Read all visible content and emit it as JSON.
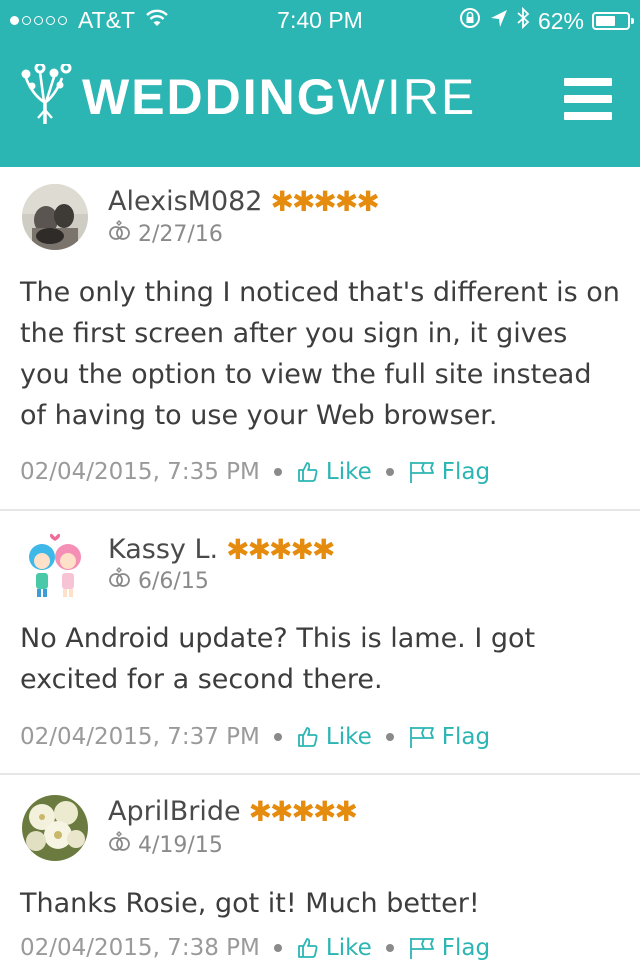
{
  "status_bar": {
    "carrier": "AT&T",
    "time": "7:40 PM",
    "battery": "62%",
    "signal_bars": 1,
    "icons": [
      "wifi-icon",
      "rotation-lock-icon",
      "location-icon",
      "bluetooth-icon",
      "battery-icon"
    ]
  },
  "header": {
    "logo_bold": "WEDDING",
    "logo_thin": "WIRE",
    "menu_icon": "hamburger-menu-icon"
  },
  "colors": {
    "brand": "#2bb5b3",
    "stars": "#e58b0e"
  },
  "comments": [
    {
      "author": "AlexisM082",
      "stars": "✱✱✱✱✱",
      "wedding_date": "2/27/16",
      "text": "The only thing I noticed that's different is on the first screen after you sign in, it gives you the option to view the full site instead of having to use your Web browser.",
      "posted": "02/04/2015, 7:35 PM",
      "like_label": "Like",
      "flag_label": "Flag"
    },
    {
      "author": "Kassy L.",
      "stars": "✱✱✱✱✱",
      "wedding_date": "6/6/15",
      "text": "No Android update? This is lame. I got excited for a second there.",
      "posted": "02/04/2015, 7:37 PM",
      "like_label": "Like",
      "flag_label": "Flag"
    },
    {
      "author": "AprilBride",
      "stars": "✱✱✱✱✱",
      "wedding_date": "4/19/15",
      "text": "Thanks Rosie, got it! Much better!",
      "posted": "02/04/2015, 7:38 PM",
      "like_label": "Like",
      "flag_label": "Flag"
    }
  ]
}
